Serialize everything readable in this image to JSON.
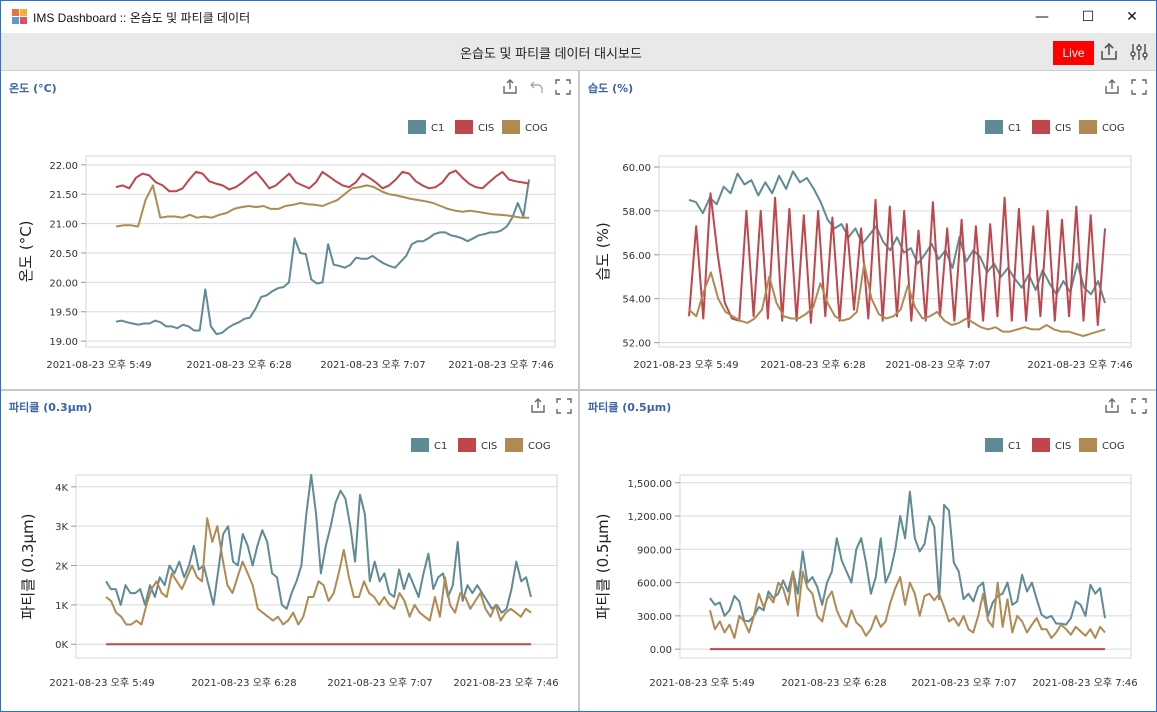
{
  "window": {
    "title": "IMS Dashboard :: 온습도 및 파티클 데이터",
    "minimize_glyph": "—",
    "maximize_glyph": "☐",
    "close_glyph": "✕"
  },
  "header": {
    "title": "온습도 및 파티클 데이터 대시보드",
    "live_label": "Live",
    "icons": [
      "share-icon",
      "settings-sliders-icon"
    ]
  },
  "colors": {
    "C1": "#5e8b95",
    "CIS": "#c0464c",
    "COG": "#b08a52",
    "title": "#3a64a8",
    "live": "#ff0000"
  },
  "panels": [
    {
      "title": "온도 (°C)",
      "icons": [
        "export-icon",
        "undo-icon",
        "fullscreen-icon"
      ]
    },
    {
      "title": "습도 (%)",
      "icons": [
        "export-icon",
        "fullscreen-icon"
      ]
    },
    {
      "title": "파티클 (0.3μm)",
      "icons": [
        "export-icon",
        "fullscreen-icon"
      ]
    },
    {
      "title": "파티클 (0.5μm)",
      "icons": [
        "export-icon",
        "fullscreen-icon"
      ]
    }
  ],
  "chart_data": [
    {
      "type": "line",
      "ylabel": "온도 (°C)",
      "ylim": [
        18.9,
        22.15
      ],
      "yticks": [
        19.0,
        19.5,
        20.0,
        20.5,
        21.0,
        21.5,
        22.0
      ],
      "ytick_labels": [
        "19.00",
        "19.50",
        "20.00",
        "20.50",
        "21.00",
        "21.50",
        "22.00"
      ],
      "xtick_labels": [
        "2021-08-23 오후 5:49",
        "2021-08-23 오후 6:28",
        "2021-08-23 오후 7:07",
        "2021-08-23 오후 7:46"
      ],
      "legend": [
        "C1",
        "CIS",
        "COG"
      ],
      "grid": true,
      "series": [
        {
          "name": "C1",
          "values": [
            19.33,
            19.35,
            19.32,
            19.3,
            19.28,
            19.3,
            19.3,
            19.35,
            19.32,
            19.25,
            19.25,
            19.22,
            19.28,
            19.25,
            19.18,
            19.18,
            19.88,
            19.25,
            19.12,
            19.14,
            19.22,
            19.28,
            19.32,
            19.38,
            19.4,
            19.55,
            19.75,
            19.78,
            19.85,
            19.9,
            19.92,
            20.0,
            20.75,
            20.5,
            20.48,
            20.05,
            19.98,
            20.0,
            20.65,
            20.3,
            20.28,
            20.25,
            20.3,
            20.42,
            20.4,
            20.4,
            20.45,
            20.38,
            20.32,
            20.28,
            20.25,
            20.35,
            20.45,
            20.65,
            20.7,
            20.7,
            20.75,
            20.82,
            20.85,
            20.85,
            20.8,
            20.78,
            20.75,
            20.7,
            20.75,
            20.8,
            20.82,
            20.85,
            20.85,
            20.88,
            20.95,
            21.1,
            21.35,
            21.12,
            21.75
          ]
        },
        {
          "name": "CIS",
          "values": [
            21.62,
            21.65,
            21.6,
            21.78,
            21.85,
            21.82,
            21.7,
            21.65,
            21.55,
            21.55,
            21.6,
            21.75,
            21.88,
            21.85,
            21.72,
            21.68,
            21.65,
            21.58,
            21.62,
            21.7,
            21.8,
            21.88,
            21.75,
            21.6,
            21.65,
            21.75,
            21.85,
            21.7,
            21.65,
            21.6,
            21.7,
            21.88,
            21.8,
            21.72,
            21.65,
            21.62,
            21.7,
            21.85,
            21.78,
            21.7,
            21.6,
            21.65,
            21.75,
            21.88,
            21.85,
            21.72,
            21.65,
            21.6,
            21.62,
            21.7,
            21.85,
            21.9,
            21.78,
            21.68,
            21.62,
            21.6,
            21.7,
            21.8,
            21.88,
            21.75,
            21.72,
            21.7,
            21.68
          ]
        },
        {
          "name": "COG",
          "values": [
            20.95,
            20.97,
            20.97,
            20.95,
            21.4,
            21.65,
            21.1,
            21.12,
            21.12,
            21.1,
            21.15,
            21.1,
            21.12,
            21.1,
            21.15,
            21.18,
            21.25,
            21.28,
            21.3,
            21.28,
            21.3,
            21.25,
            21.25,
            21.3,
            21.32,
            21.35,
            21.33,
            21.32,
            21.3,
            21.35,
            21.4,
            21.5,
            21.6,
            21.62,
            21.65,
            21.62,
            21.55,
            21.5,
            21.48,
            21.45,
            21.42,
            21.4,
            21.38,
            21.35,
            21.3,
            21.25,
            21.22,
            21.2,
            21.22,
            21.2,
            21.18,
            21.16,
            21.15,
            21.14,
            21.12,
            21.1,
            21.1
          ]
        }
      ]
    },
    {
      "type": "line",
      "ylabel": "습도 (%)",
      "ylim": [
        51.8,
        60.5
      ],
      "yticks": [
        52,
        54,
        56,
        58,
        60
      ],
      "ytick_labels": [
        "52.00",
        "54.00",
        "56.00",
        "58.00",
        "60.00"
      ],
      "xtick_labels": [
        "2021-08-23 오후 5:49",
        "2021-08-23 오후 6:28",
        "2021-08-23 오후 7:07",
        "2021-08-23 오후 7:46"
      ],
      "legend": [
        "C1",
        "CIS",
        "COG"
      ],
      "grid": true,
      "series": [
        {
          "name": "C1",
          "values": [
            58.5,
            58.4,
            57.9,
            58.6,
            58.3,
            59.1,
            58.8,
            59.7,
            59.2,
            59.4,
            58.7,
            59.3,
            58.8,
            59.6,
            59.0,
            59.8,
            59.3,
            59.5,
            59.0,
            58.4,
            57.6,
            57.2,
            57.4,
            56.8,
            57.2,
            56.5,
            56.9,
            57.3,
            56.6,
            56.2,
            56.8,
            56.1,
            56.3,
            55.6,
            56.0,
            56.5,
            55.8,
            56.2,
            55.4,
            56.8,
            55.7,
            56.2,
            55.9,
            55.2,
            55.6,
            55.0,
            55.4,
            54.9,
            54.5,
            55.1,
            54.4,
            55.3,
            54.7,
            54.2,
            54.8,
            54.3,
            55.6,
            54.5,
            54.2,
            54.8,
            53.8
          ]
        },
        {
          "name": "CIS",
          "values": [
            53.2,
            57.3,
            53.1,
            58.8,
            56.0,
            53.8,
            53.1,
            53.0,
            58.0,
            53.2,
            58.0,
            53.1,
            58.6,
            53.0,
            58.1,
            53.0,
            57.8,
            52.9,
            58.0,
            53.2,
            57.7,
            53.0,
            57.4,
            53.5,
            57.2,
            53.1,
            58.5,
            53.0,
            58.2,
            53.2,
            58.0,
            53.0,
            57.1,
            53.0,
            58.4,
            53.2,
            57.2,
            53.0,
            57.6,
            52.7,
            57.3,
            53.0,
            57.4,
            53.2,
            58.6,
            53.0,
            58.1,
            53.0,
            57.3,
            53.2,
            58.0,
            53.0,
            57.6,
            53.2,
            58.2,
            53.0,
            57.8,
            52.8,
            57.2
          ]
        },
        {
          "name": "COG",
          "values": [
            53.5,
            53.2,
            54.3,
            55.2,
            54.0,
            53.4,
            53.2,
            53.0,
            52.9,
            53.1,
            53.5,
            55.0,
            53.8,
            53.2,
            53.1,
            53.1,
            53.3,
            53.6,
            54.7,
            53.8,
            53.2,
            53.0,
            53.1,
            53.4,
            55.6,
            54.0,
            53.3,
            53.1,
            53.2,
            53.5,
            54.6,
            53.6,
            53.1,
            53.2,
            53.4,
            53.0,
            52.8,
            52.9,
            53.1,
            52.9,
            52.7,
            52.6,
            52.7,
            52.5,
            52.5,
            52.6,
            52.7,
            52.6,
            52.6,
            52.8,
            52.6,
            52.5,
            52.5,
            52.4,
            52.3,
            52.4,
            52.5,
            52.6
          ]
        }
      ]
    },
    {
      "type": "line",
      "ylabel": "파티클 (0.3μm)",
      "ylim": [
        -350,
        4300
      ],
      "yticks": [
        0,
        1000,
        2000,
        3000,
        4000
      ],
      "ytick_labels": [
        "0K",
        "1K",
        "2K",
        "3K",
        "4K"
      ],
      "xtick_labels": [
        "2021-08-23 오후 5:49",
        "2021-08-23 오후 6:28",
        "2021-08-23 오후 7:07",
        "2021-08-23 오후 7:46"
      ],
      "legend": [
        "C1",
        "CIS",
        "COG"
      ],
      "grid": true,
      "series": [
        {
          "name": "C1",
          "values": [
            1600,
            1400,
            1400,
            1000,
            1500,
            1300,
            1300,
            1400,
            1000,
            1500,
            1200,
            1700,
            1500,
            2000,
            1800,
            2100,
            1700,
            2000,
            2500,
            1900,
            2000,
            1500,
            1000,
            1900,
            2800,
            3000,
            2100,
            2000,
            2800,
            2500,
            2000,
            2500,
            2900,
            2600,
            1800,
            1700,
            1000,
            900,
            1300,
            1600,
            2000,
            3300,
            4300,
            3300,
            1800,
            2500,
            3000,
            3600,
            3900,
            3700,
            3000,
            2100,
            3800,
            3300,
            1600,
            2100,
            1600,
            1800,
            1300,
            1200,
            1900,
            1400,
            1800,
            1500,
            1200,
            1800,
            2300,
            1400,
            1700,
            1800,
            1200,
            1500,
            2600,
            1100,
            1500,
            1300,
            1500,
            1300,
            1100,
            900,
            1000,
            800,
            900,
            1400,
            2100,
            1600,
            1700,
            1200
          ]
        },
        {
          "name": "CIS",
          "values": [
            0,
            0,
            0,
            0,
            0,
            0,
            0,
            0,
            0,
            0,
            0,
            0,
            0,
            0,
            0,
            0,
            0,
            0,
            0,
            0,
            0,
            0,
            0,
            0,
            0,
            0,
            0,
            0,
            0,
            0,
            0,
            0,
            0,
            0,
            0,
            0,
            0,
            0,
            0,
            0
          ]
        },
        {
          "name": "COG",
          "values": [
            1200,
            1100,
            800,
            700,
            500,
            500,
            600,
            500,
            1000,
            1400,
            1600,
            1300,
            1200,
            1800,
            1600,
            1400,
            1700,
            2000,
            1700,
            1600,
            3200,
            2600,
            3000,
            2200,
            1500,
            1300,
            1700,
            2100,
            1800,
            1500,
            900,
            800,
            700,
            600,
            700,
            500,
            600,
            800,
            500,
            700,
            1200,
            1200,
            1600,
            1500,
            1100,
            1300,
            1800,
            2400,
            1700,
            1200,
            1200,
            1600,
            1300,
            1200,
            1000,
            1200,
            1000,
            900,
            1300,
            1100,
            700,
            1000,
            800,
            700,
            600,
            1200,
            700,
            1700,
            1000,
            800,
            1300,
            1200,
            900,
            1100,
            1300,
            900,
            700,
            1000,
            600,
            800,
            900,
            800,
            700,
            900,
            800
          ]
        }
      ]
    },
    {
      "type": "line",
      "ylabel": "파티클 (0.5μm)",
      "ylim": [
        -80,
        1570
      ],
      "yticks": [
        0,
        300,
        600,
        900,
        1200,
        1500
      ],
      "ytick_labels": [
        "0.00",
        "300.00",
        "600.00",
        "900.00",
        "1,200.00",
        "1,500.00"
      ],
      "xtick_labels": [
        "2021-08-23 오후 5:49",
        "2021-08-23 오후 6:28",
        "2021-08-23 오후 7:07",
        "2021-08-23 오후 7:46"
      ],
      "legend": [
        "C1",
        "CIS",
        "COG"
      ],
      "grid": true,
      "series": [
        {
          "name": "C1",
          "values": [
            460,
            400,
            420,
            300,
            350,
            480,
            430,
            260,
            250,
            300,
            380,
            350,
            520,
            460,
            500,
            620,
            520,
            700,
            500,
            880,
            600,
            650,
            560,
            400,
            600,
            700,
            1000,
            800,
            700,
            600,
            900,
            1000,
            780,
            500,
            650,
            1000,
            600,
            700,
            900,
            1200,
            1000,
            1420,
            1000,
            880,
            950,
            1200,
            1100,
            450,
            1300,
            1250,
            780,
            700,
            450,
            500,
            430,
            560,
            600,
            300,
            420,
            480,
            500,
            600,
            400,
            430,
            670,
            520,
            600,
            450,
            310,
            280,
            300,
            230,
            230,
            220,
            280,
            430,
            400,
            300,
            580,
            500,
            550,
            280
          ]
        },
        {
          "name": "CIS",
          "values": [
            0,
            0,
            0,
            0,
            0,
            0,
            0,
            0,
            0,
            0,
            0,
            0,
            0,
            0,
            0,
            0,
            0,
            0,
            0,
            0,
            0,
            0,
            0,
            0,
            0,
            0,
            0,
            0,
            0,
            0,
            0,
            0,
            0,
            0,
            0,
            0,
            0,
            0,
            0,
            0
          ]
        },
        {
          "name": "COG",
          "values": [
            350,
            180,
            250,
            150,
            220,
            100,
            300,
            250,
            150,
            300,
            500,
            380,
            480,
            420,
            600,
            550,
            400,
            700,
            300,
            700,
            550,
            500,
            300,
            250,
            450,
            520,
            350,
            250,
            200,
            350,
            240,
            200,
            120,
            180,
            300,
            200,
            250,
            420,
            550,
            650,
            400,
            600,
            500,
            300,
            480,
            500,
            440,
            500,
            380,
            250,
            280,
            210,
            300,
            180,
            150,
            300,
            500,
            260,
            200,
            600,
            200,
            450,
            150,
            300,
            250,
            150,
            220,
            280,
            180,
            180,
            100,
            150,
            220,
            180,
            130,
            200,
            160,
            120,
            180,
            100,
            200,
            150
          ]
        }
      ]
    }
  ]
}
